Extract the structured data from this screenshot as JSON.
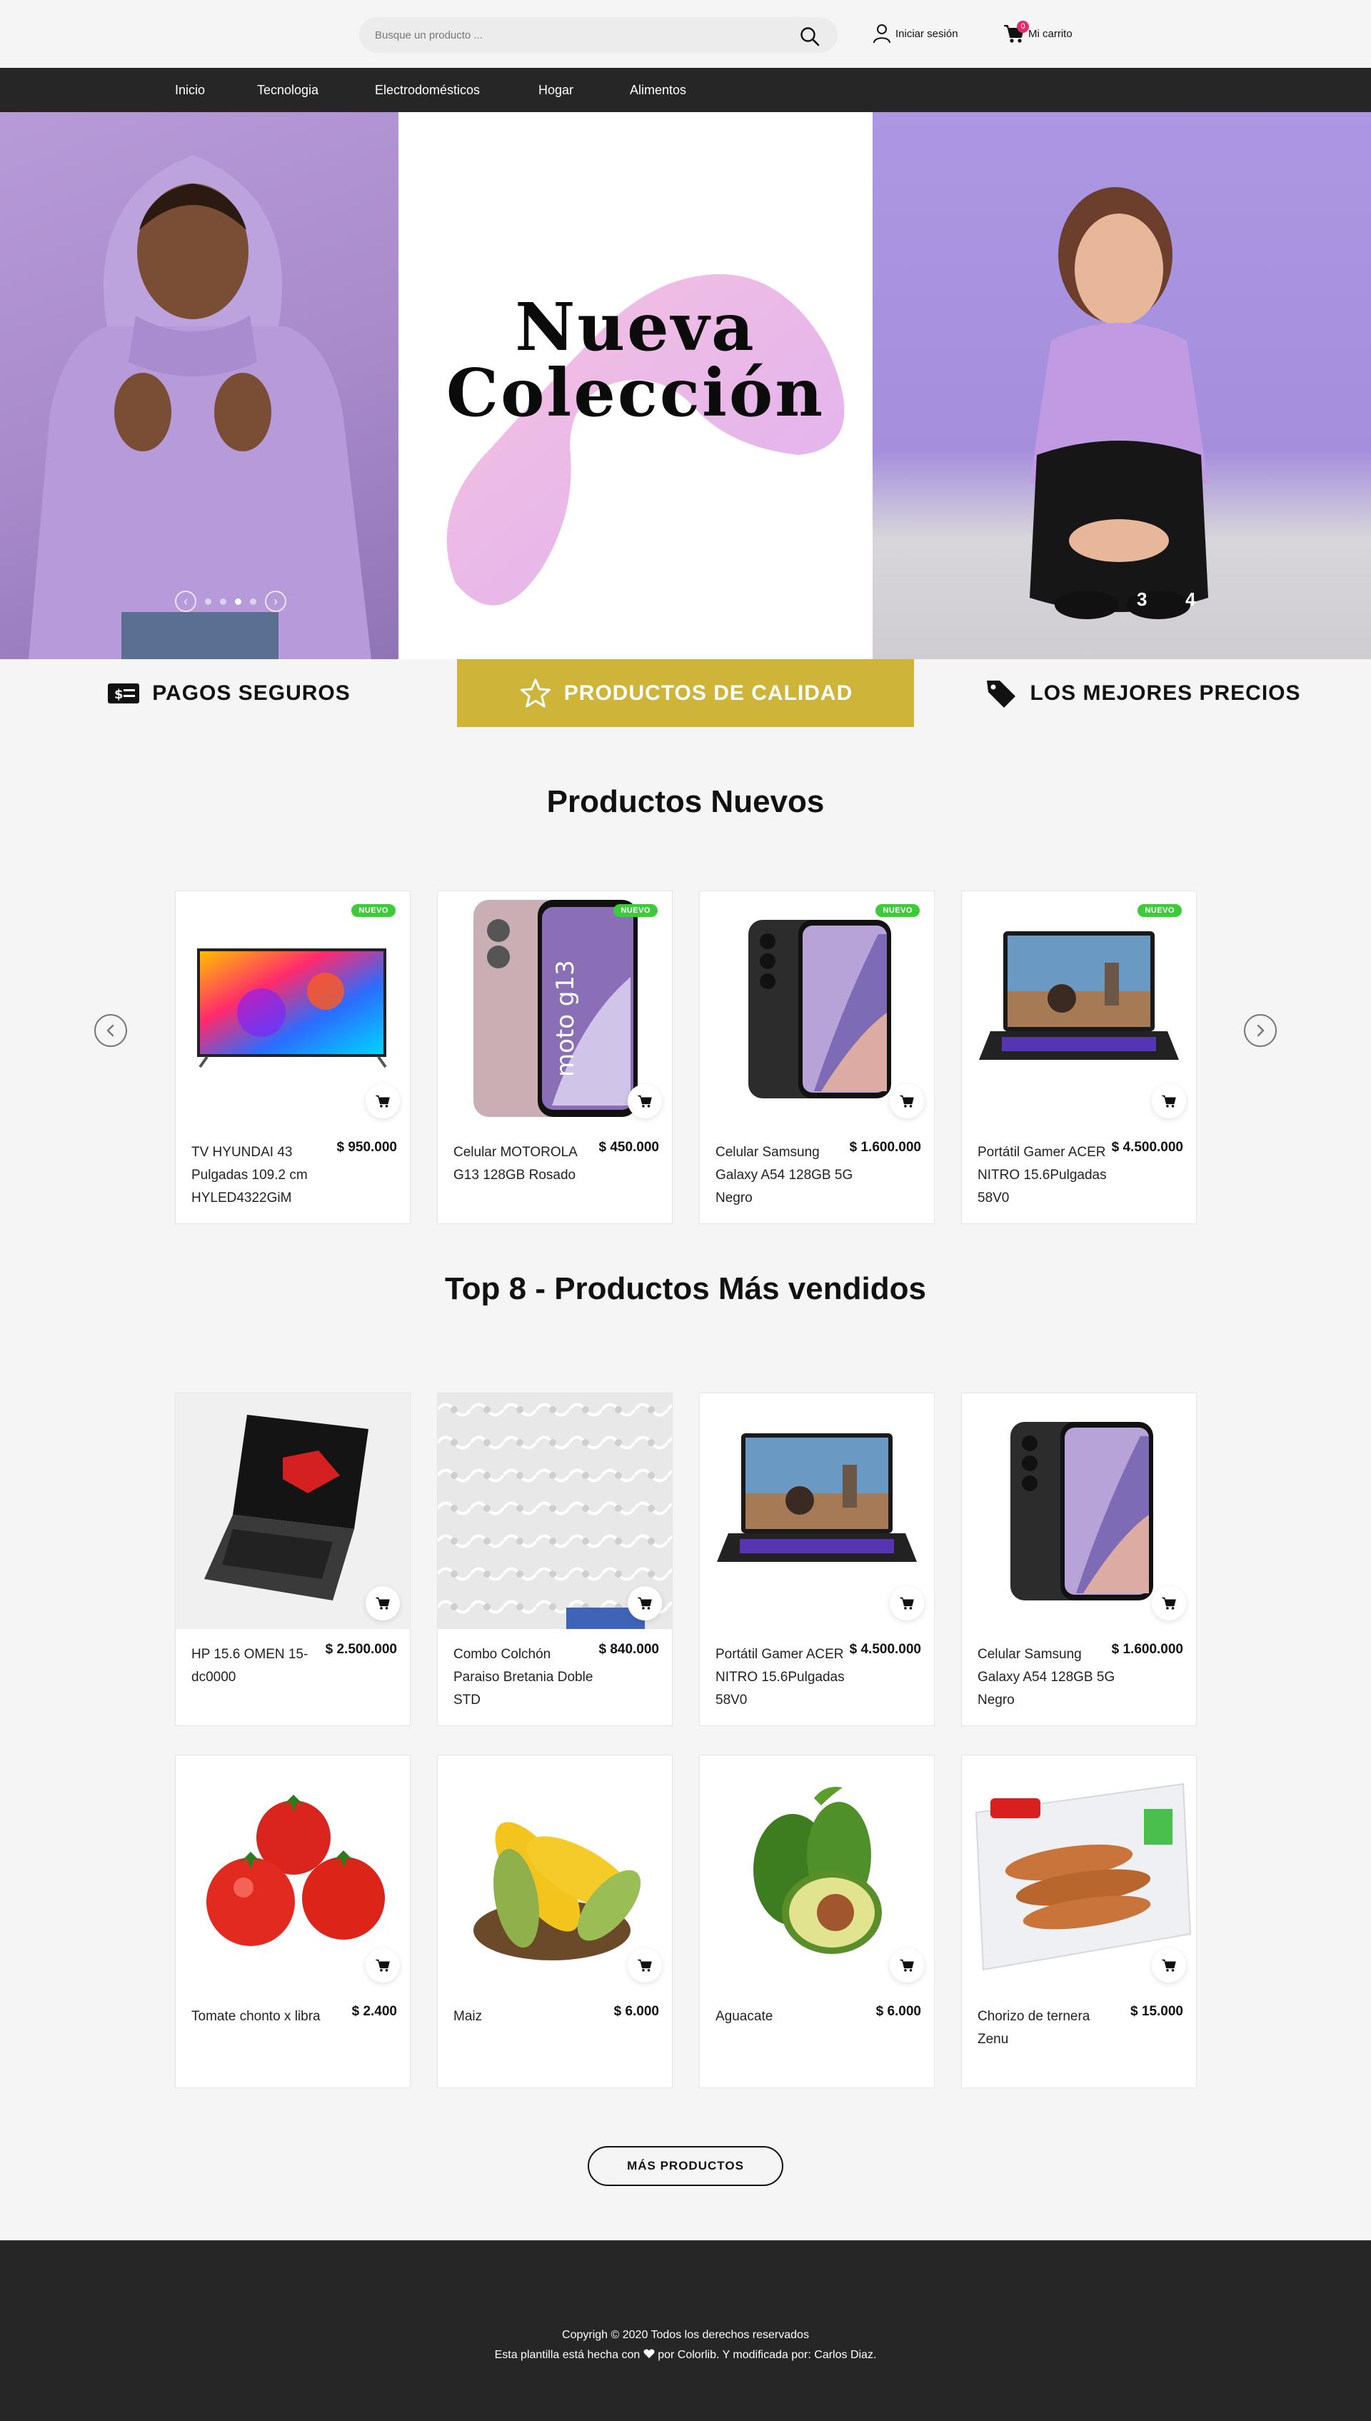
{
  "header": {
    "search_placeholder": "Busque un producto ...",
    "login_label": "Iniciar sesión",
    "cart_label": "Mi carrito",
    "cart_count": "0"
  },
  "nav": {
    "items": [
      "Inicio",
      "Tecnologia",
      "Electrodomésticos",
      "Hogar",
      "Alimentos"
    ]
  },
  "hero": {
    "title_line1": "Nueva",
    "title_line2": "Colección",
    "slide_numbers": [
      "3",
      "4"
    ]
  },
  "features": [
    {
      "label": "PAGOS SEGUROS",
      "icon": "money-bill-icon"
    },
    {
      "label": "PRODUCTOS DE CALIDAD",
      "icon": "star-icon"
    },
    {
      "label": "LOS MEJORES PRECIOS",
      "icon": "price-tag-icon"
    }
  ],
  "new_products": {
    "title": "Productos Nuevos",
    "badge": "NUEVO",
    "items": [
      {
        "name": "TV HYUNDAI 43 Pulgadas 109.2 cm HYLED4322GiM",
        "price": "$ 950.000",
        "image": "tv"
      },
      {
        "name": "Celular MOTOROLA G13 128GB Rosado",
        "price": "$ 450.000",
        "image": "motorola"
      },
      {
        "name": "Celular Samsung Galaxy A54 128GB 5G Negro",
        "price": "$ 1.600.000",
        "image": "samsung"
      },
      {
        "name": "Portátil Gamer ACER NITRO 15.6Pulgadas 58V0",
        "price": "$ 4.500.000",
        "image": "acer"
      }
    ]
  },
  "top_products": {
    "title": "Top 8 - Productos Más vendidos",
    "items": [
      {
        "name": "HP 15.6 OMEN 15-dc0000",
        "price": "$ 2.500.000",
        "image": "hp"
      },
      {
        "name": "Combo Colchón Paraiso Bretania Doble STD",
        "price": "$ 840.000",
        "image": "mattress"
      },
      {
        "name": "Portátil Gamer ACER NITRO 15.6Pulgadas 58V0",
        "price": "$ 4.500.000",
        "image": "acer"
      },
      {
        "name": "Celular Samsung Galaxy A54 128GB 5G Negro",
        "price": "$ 1.600.000",
        "image": "samsung"
      },
      {
        "name": "Tomate chonto x libra",
        "price": "$ 2.400",
        "image": "tomato"
      },
      {
        "name": "Maiz",
        "price": "$ 6.000",
        "image": "corn"
      },
      {
        "name": "Aguacate",
        "price": "$ 6.000",
        "image": "avocado"
      },
      {
        "name": "Chorizo de ternera Zenu",
        "price": "$ 15.000",
        "image": "chorizo"
      }
    ]
  },
  "more_button": "MÁS PRODUCTOS",
  "footer": {
    "line1": "Copyrigh © 2020 Todos los derechos reservados",
    "line2_before": "Esta plantilla está hecha con",
    "line2_after": "por Colorlib. Y modificada por: Carlos Diaz."
  },
  "colors": {
    "accent_gold": "#cfb43a",
    "nav_dark": "#262626",
    "badge_green": "#3dcb3a",
    "cart_badge": "#e6286d",
    "hero_purple": "#a88acb"
  }
}
